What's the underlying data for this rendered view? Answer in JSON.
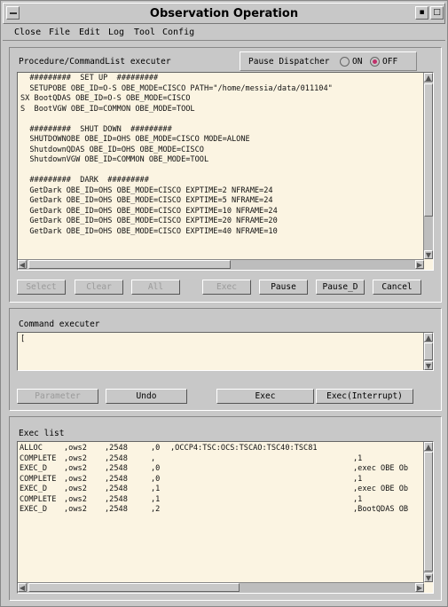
{
  "window": {
    "title": "Observation Operation"
  },
  "menu": [
    "Close",
    "File",
    "Edit",
    "Log",
    "Tool",
    "Config"
  ],
  "procedure": {
    "label": "Procedure/CommandList executer",
    "pause_dispatcher": {
      "label": "Pause Dispatcher",
      "on_label": "ON",
      "off_label": "OFF",
      "selected": "OFF"
    },
    "lines": [
      "  #########  SET UP  #########",
      "  SETUPOBE OBE_ID=O-S OBE_MODE=CISCO PATH=\"/home/messia/data/011104\"",
      "SX BootQDAS OBE_ID=O-S OBE_MODE=CISCO",
      "S  BootVGW OBE_ID=COMMON OBE_MODE=TOOL",
      "",
      "  #########  SHUT DOWN  #########",
      "  SHUTDOWNOBE OBE_ID=OHS OBE_MODE=CISCO MODE=ALONE",
      "  ShutdownQDAS OBE_ID=OHS OBE_MODE=CISCO",
      "  ShutdownVGW OBE_ID=COMMON OBE_MODE=TOOL",
      "",
      "  #########  DARK  #########",
      "  GetDark OBE_ID=OHS OBE_MODE=CISCO EXPTIME=2 NFRAME=24",
      "  GetDark OBE_ID=OHS OBE_MODE=CISCO EXPTIME=5 NFRAME=24",
      "  GetDark OBE_ID=OHS OBE_MODE=CISCO EXPTIME=10 NFRAME=24",
      "  GetDark OBE_ID=OHS OBE_MODE=CISCO EXPTIME=20 NFRAME=20",
      "  GetDark OBE_ID=OHS OBE_MODE=CISCO EXPTIME=40 NFRAME=10"
    ],
    "buttons": [
      "Select",
      "Clear",
      "All",
      "Exec",
      "Pause",
      "Pause_D",
      "Cancel"
    ]
  },
  "command": {
    "label": "Command executer",
    "value": "[",
    "buttons": [
      "Parameter",
      "Undo",
      "Exec",
      "Exec(Interrupt)"
    ]
  },
  "exec_list": {
    "label": "Exec list",
    "rows": [
      [
        "ALLOC",
        ",ows2",
        ",2548",
        ",0",
        ",OCCP4:TSC:OCS:TSCAO:TSC40:TSC81",
        ""
      ],
      [
        "COMPLETE",
        ",ows2",
        ",2548",
        ",",
        "",
        ",1"
      ],
      [
        "EXEC_D",
        ",ows2",
        ",2548",
        ",0",
        "",
        ",exec OBE Ob"
      ],
      [
        "COMPLETE",
        ",ows2",
        ",2548",
        ",0",
        "",
        ",1"
      ],
      [
        "EXEC_D",
        ",ows2",
        ",2548",
        ",1",
        "",
        ",exec OBE Ob"
      ],
      [
        "COMPLETE",
        ",ows2",
        ",2548",
        ",1",
        "",
        ",1"
      ],
      [
        "EXEC_D",
        ",ows2",
        ",2548",
        ",2",
        "",
        ",BootQDAS OB"
      ]
    ]
  }
}
